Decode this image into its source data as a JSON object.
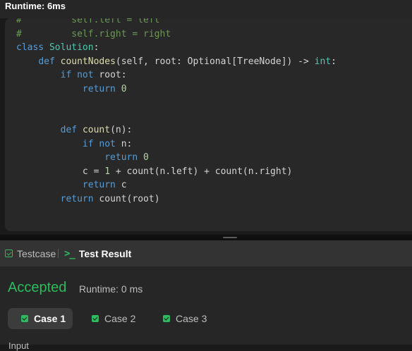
{
  "header": {
    "title": "Runtime: 6ms"
  },
  "code": {
    "lines": [
      [
        [
          "#         self.left = left",
          "t-cmt"
        ]
      ],
      [
        [
          "#         self.right = right",
          "t-cmt"
        ]
      ],
      [
        [
          "class ",
          "t-kw"
        ],
        [
          "Solution",
          "t-cls"
        ],
        [
          ":",
          "t-pl"
        ]
      ],
      [
        [
          "    ",
          "t-pl"
        ],
        [
          "def ",
          "t-kw"
        ],
        [
          "countNodes",
          "t-fn"
        ],
        [
          "(self, root: Optional[TreeNode]) -> ",
          "t-pl"
        ],
        [
          "int",
          "t-cls"
        ],
        [
          ":",
          "t-pl"
        ]
      ],
      [
        [
          "        ",
          "t-pl"
        ],
        [
          "if not ",
          "t-kw"
        ],
        [
          "root:",
          "t-pl"
        ]
      ],
      [
        [
          "            ",
          "t-pl"
        ],
        [
          "return ",
          "t-kw"
        ],
        [
          "0",
          "t-num"
        ]
      ],
      [],
      [],
      [
        [
          "        ",
          "t-pl"
        ],
        [
          "def ",
          "t-kw"
        ],
        [
          "count",
          "t-fn"
        ],
        [
          "(n):",
          "t-pl"
        ]
      ],
      [
        [
          "            ",
          "t-pl"
        ],
        [
          "if not ",
          "t-kw"
        ],
        [
          "n:",
          "t-pl"
        ]
      ],
      [
        [
          "                ",
          "t-pl"
        ],
        [
          "return ",
          "t-kw"
        ],
        [
          "0",
          "t-num"
        ]
      ],
      [
        [
          "            c = ",
          "t-pl"
        ],
        [
          "1",
          "t-num"
        ],
        [
          " + count(n.left) + count(n.right)",
          "t-pl"
        ]
      ],
      [
        [
          "            ",
          "t-pl"
        ],
        [
          "return ",
          "t-kw"
        ],
        [
          "c",
          "t-pl"
        ]
      ],
      [
        [
          "        ",
          "t-pl"
        ],
        [
          "return ",
          "t-kw"
        ],
        [
          "count(root)",
          "t-pl"
        ]
      ]
    ]
  },
  "tabs": {
    "testcase": "Testcase",
    "test_result": "Test Result"
  },
  "result": {
    "status": "Accepted",
    "runtime": "Runtime: 0 ms",
    "status_color": "#2cbb5d"
  },
  "cases": {
    "case1": "Case 1",
    "case2": "Case 2",
    "case3": "Case 3"
  },
  "input_label": "Input"
}
